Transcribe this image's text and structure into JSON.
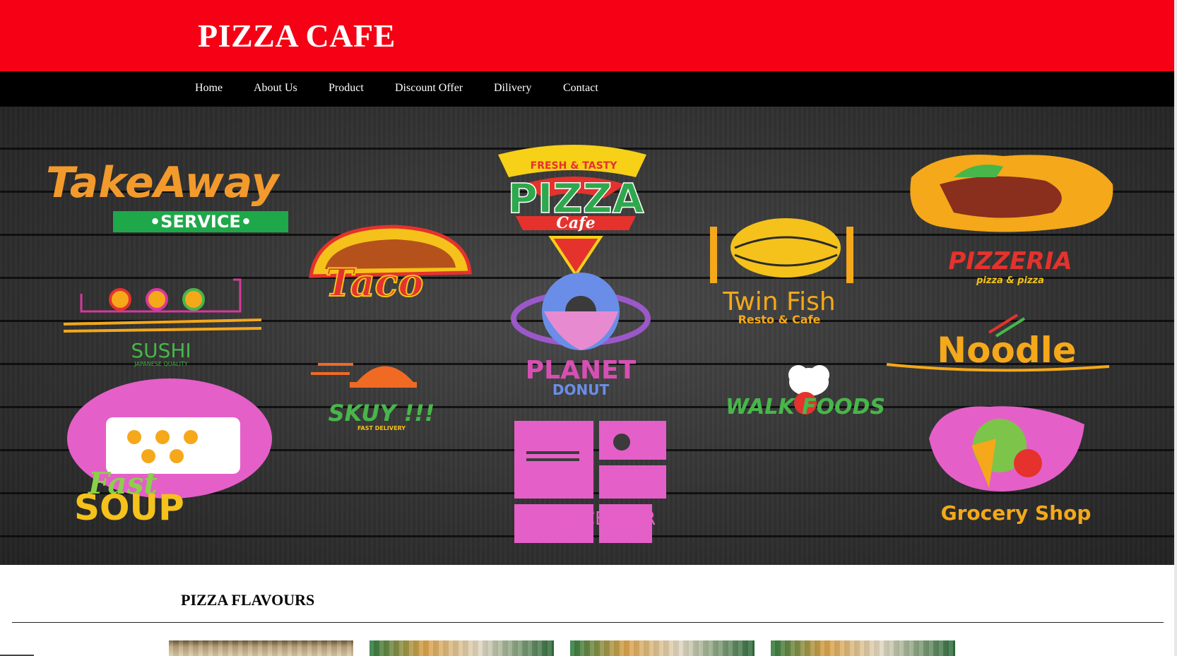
{
  "header": {
    "title": "PIZZA CAFE"
  },
  "nav": {
    "items": [
      {
        "label": "Home"
      },
      {
        "label": "About Us"
      },
      {
        "label": "Product"
      },
      {
        "label": "Discount Offer"
      },
      {
        "label": "Dilivery"
      },
      {
        "label": "Contact"
      }
    ]
  },
  "banner": {
    "logos": {
      "takeaway": {
        "line1": "TakeAway",
        "line2": "•SERVICE•"
      },
      "pizza": {
        "top": "FRESH & TASTY",
        "main": "PIZZA",
        "sub": "Cafe"
      },
      "twinfish": {
        "main": "Twin Fish",
        "sub": "Resto & Cafe"
      },
      "pizzeria": {
        "main": "PIZZERIA",
        "sub": "pizza & pizza"
      },
      "taco": {
        "main": "Taco"
      },
      "sushi": {
        "main": "SUSHI",
        "sub": "JAPANESE QUALITY"
      },
      "planet": {
        "main": "PLANET",
        "sub": "DONUT"
      },
      "noodle": {
        "main": "Noodle"
      },
      "skuy": {
        "main": "SKUY !!!",
        "sub": "FAST DELIVERY"
      },
      "walkfoods": {
        "main": "WALK FOODS"
      },
      "soup": {
        "line1": "Fast",
        "line2": "SOUP"
      },
      "foodcenter": {
        "main": "FOOD CENTER"
      },
      "grocery": {
        "main": "Grocery Shop"
      }
    }
  },
  "section": {
    "title": "PIZZA FLAVOURS"
  },
  "colors": {
    "header_bg": "#f50014",
    "nav_bg": "#000000"
  }
}
